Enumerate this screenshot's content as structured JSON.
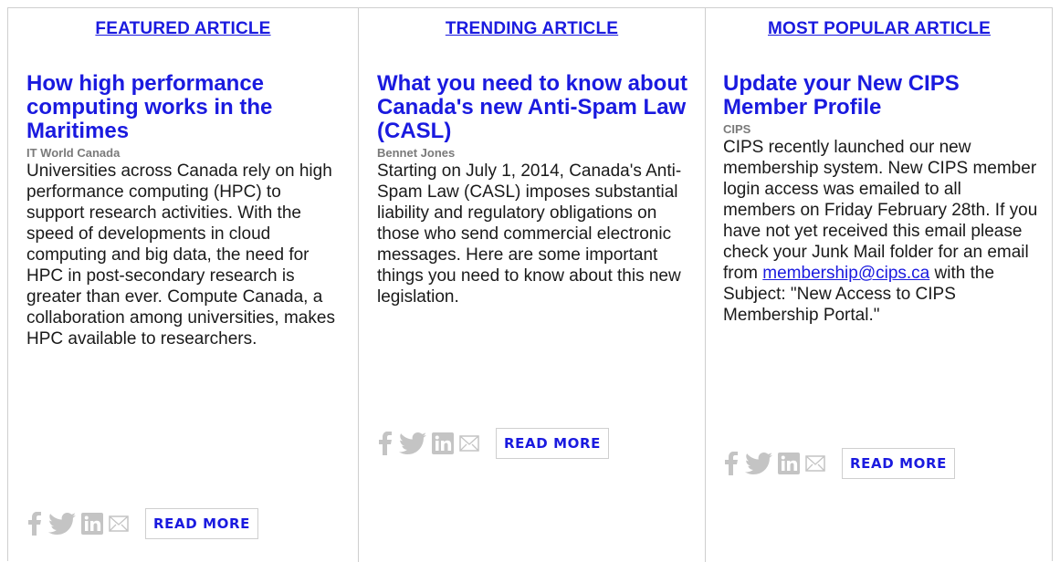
{
  "columns": [
    {
      "header": "FEATURED ARTICLE",
      "title": "How high performance computing works in the Maritimes",
      "source": "IT World Canada",
      "description": "Universities across Canada rely on high performance computing (HPC) to support research activities. With the speed of developments in cloud computing and big data, the need for HPC in post-secondary research is greater than ever. Compute Canada, a collaboration among universities, makes HPC available to researchers.",
      "read_more": "READ MORE"
    },
    {
      "header": "TRENDING ARTICLE",
      "title": "What you need to know about Canada's new Anti-Spam Law (CASL)",
      "source": "Bennet Jones",
      "description": "Starting on July 1, 2014, Canada's Anti-Spam Law (CASL) imposes substantial liability and regulatory obligations on those who send commercial electronic messages. Here are some important things you need to know about this new legislation.",
      "read_more": "READ MORE"
    },
    {
      "header": "MOST POPULAR ARTICLE",
      "title": "Update your New CIPS Member Profile",
      "source": "CIPS",
      "description_before_link": "CIPS recently launched our new membership system. New CIPS member login access was emailed to all members on Friday February 28th. If you have not yet received this email please check your Junk Mail folder for an email from",
      "link_text": "membership@cips.ca",
      "description_after_link": "with the Subject: \"New Access to CIPS Membership Portal.\"",
      "read_more": "READ MORE"
    }
  ],
  "share_icons": [
    "facebook-icon",
    "twitter-icon",
    "linkedin-icon",
    "email-icon"
  ],
  "colors": {
    "link": "#1a1adf",
    "source": "#7a7a7a",
    "text": "#1a1a1a",
    "border": "#cfcfcf",
    "icon": "#c4c4c4"
  }
}
